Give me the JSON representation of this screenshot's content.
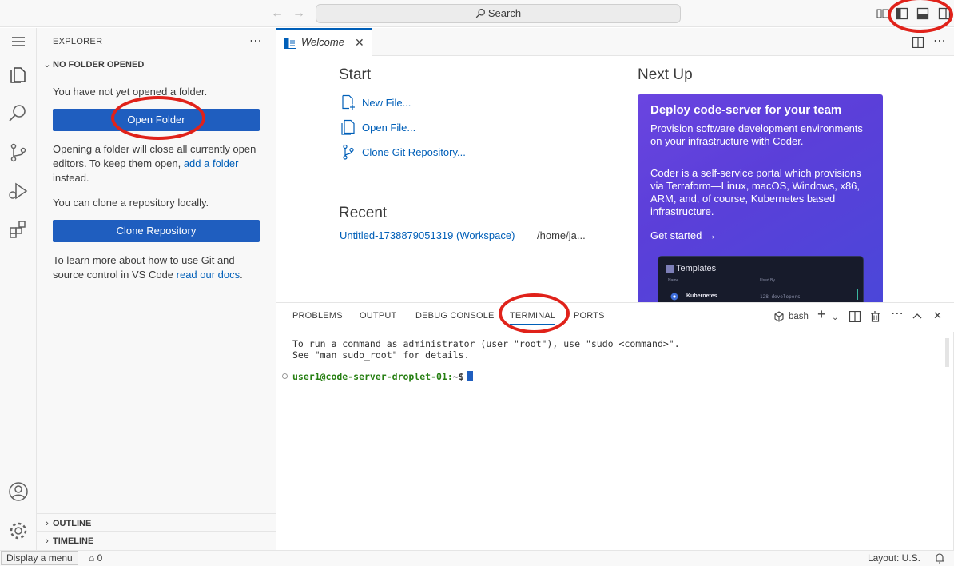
{
  "titlebar": {
    "search_label": "Search"
  },
  "explorer": {
    "title": "EXPLORER",
    "section_title": "NO FOLDER OPENED",
    "no_folder_text": "You have not yet opened a folder.",
    "open_folder_button": "Open Folder",
    "open_folder_warning_pre": "Opening a folder will close all currently open editors. To keep them open, ",
    "add_folder_link": "add a folder",
    "open_folder_warning_post": " instead.",
    "clone_text": "You can clone a repository locally.",
    "clone_button": "Clone Repository",
    "git_text_pre": "To learn more about how to use Git and source control in VS Code ",
    "git_docs_link": "read our docs",
    "git_text_post": ".",
    "outline_label": "OUTLINE",
    "timeline_label": "TIMELINE"
  },
  "tabs": [
    {
      "label": "Welcome",
      "active": true
    }
  ],
  "welcome": {
    "start_heading": "Start",
    "start_items": [
      {
        "label": "New File...",
        "icon": "new-file-icon"
      },
      {
        "label": "Open File...",
        "icon": "open-file-icon"
      },
      {
        "label": "Clone Git Repository...",
        "icon": "git-branch-icon"
      }
    ],
    "recent_heading": "Recent",
    "recent_items": [
      {
        "name": "Untitled-1738879051319 (Workspace)",
        "path": "/home/ja..."
      }
    ],
    "next_heading": "Next Up",
    "promo": {
      "title": "Deploy code-server for your team",
      "para1": "Provision software development environments on your infrastructure with Coder.",
      "para2": "Coder is a self-service portal which provisions via Terraform—Linux, macOS, Windows, x86, ARM, and, of course, Kubernetes based infrastructure.",
      "cta": "Get started",
      "image": {
        "title": "Templates",
        "col1": "Name",
        "col2": "Used By",
        "row_name": "Kubernetes",
        "row_used": "128 developers"
      }
    }
  },
  "panel": {
    "tabs": [
      "PROBLEMS",
      "OUTPUT",
      "DEBUG CONSOLE",
      "TERMINAL",
      "PORTS"
    ],
    "active_tab": "TERMINAL",
    "shell": "bash",
    "terminal_lines": [
      "To run a command as administrator (user \"root\"), use \"sudo <command>\".",
      "See \"man sudo_root\" for details."
    ],
    "prompt_user": "user1@code-server-droplet-01:",
    "prompt_rest": "~$"
  },
  "statusbar": {
    "tooltip": "Display a menu",
    "ports_count": "0",
    "layout": "Layout: U.S."
  },
  "colors": {
    "accent": "#005fb8",
    "button": "#1f5ebf",
    "annotation": "#e0221a",
    "promo_start": "#6a45e0",
    "promo_end": "#4a47d9",
    "terminal_prompt": "#267f12"
  }
}
